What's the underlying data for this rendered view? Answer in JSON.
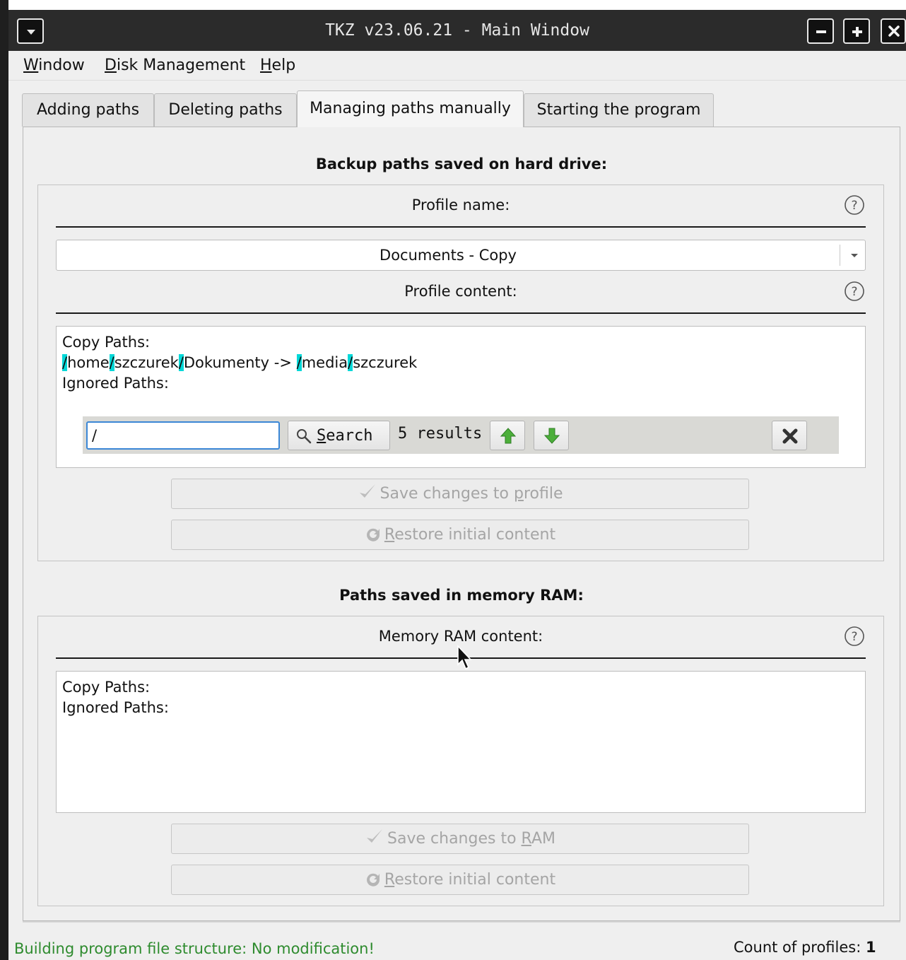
{
  "window": {
    "title": "TKZ v23.06.21 - Main Window",
    "controls": [
      "menu",
      "minimize",
      "maximize",
      "close"
    ]
  },
  "menubar": [
    {
      "accel": "W",
      "rest": "indow"
    },
    {
      "accel": "D",
      "rest": "isk Management"
    },
    {
      "accel": "H",
      "rest": "elp"
    }
  ],
  "tabs": [
    {
      "label": "Adding paths",
      "active": false
    },
    {
      "label": "Deleting paths",
      "active": false
    },
    {
      "label": "Managing paths manually",
      "active": true
    },
    {
      "label": "Starting the program",
      "active": false
    }
  ],
  "disk_section": {
    "title": "Backup paths saved on hard drive:",
    "profile_name_label": "Profile name:",
    "profile_selected": "Documents - Copy",
    "profile_content_label": "Profile content:",
    "content_lines": [
      "Copy Paths:",
      "Ignored Paths:"
    ],
    "path_segments": [
      "/",
      "home",
      "/",
      "szczurek",
      "/",
      "Dokumenty -> ",
      "/",
      "media",
      "/",
      "szczurek"
    ],
    "search": {
      "query": "/",
      "button_accel": "S",
      "button_rest": "earch",
      "results": "5 results"
    },
    "save_button": {
      "before": "Save changes to ",
      "accel": "p",
      "after": "rofile"
    },
    "restore_button": {
      "before": "",
      "accel": "R",
      "after": "estore initial content"
    }
  },
  "ram_section": {
    "title": "Paths saved in memory RAM:",
    "content_label": "Memory RAM content:",
    "content_lines": [
      "Copy Paths:",
      "Ignored Paths:"
    ],
    "save_button": {
      "before": "Save changes to ",
      "accel": "R",
      "after": "AM"
    },
    "restore_button": {
      "before": "",
      "accel": "R",
      "after": "estore initial content"
    }
  },
  "statusbar": {
    "message": "Building program file structure: No modification!",
    "profiles_label": "Count of profiles: ",
    "profiles_count": "1"
  },
  "colors": {
    "highlight": "#00d8d8",
    "status_ok": "#2e8b2e",
    "arrow_green": "#4caf3a",
    "focus_border": "#3b87d6"
  },
  "icons": {
    "help": "question-circle-icon",
    "search": "magnifier-icon",
    "prev": "green-up-arrow-icon",
    "next": "green-down-arrow-icon",
    "close_search": "x-icon",
    "save": "checkmark-icon",
    "restore": "refresh-icon"
  }
}
